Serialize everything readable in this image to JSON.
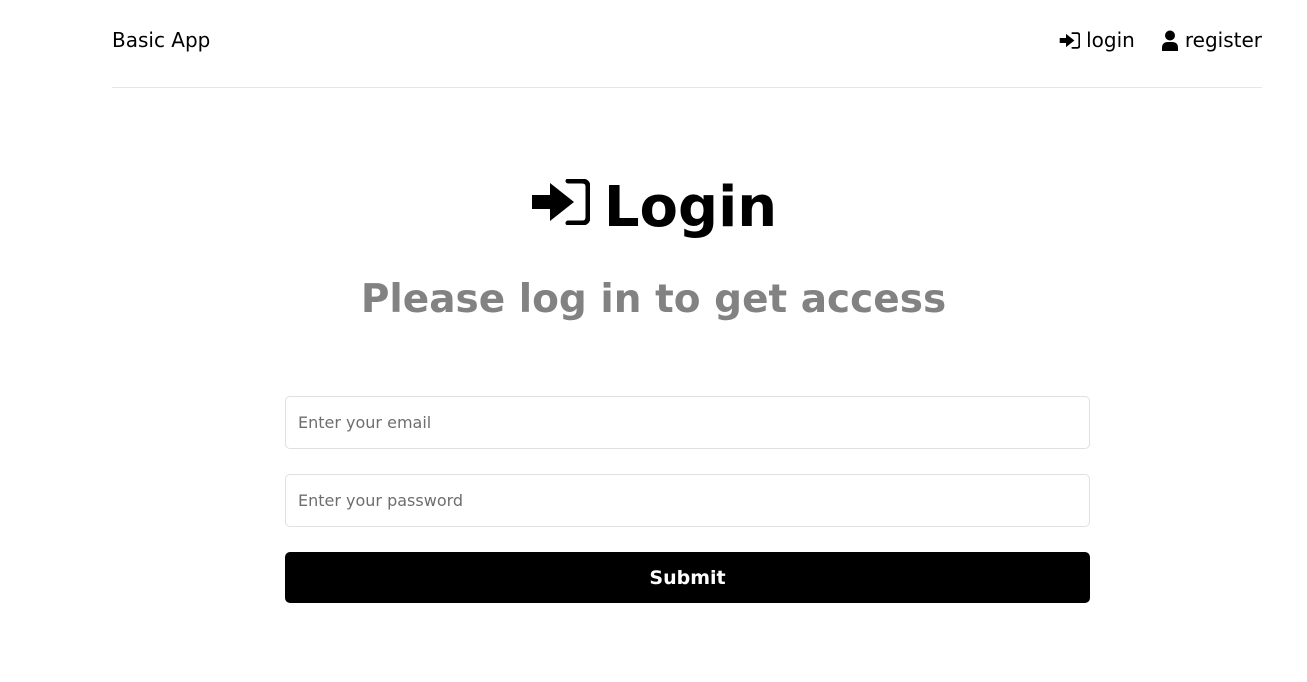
{
  "header": {
    "brand": "Basic App",
    "nav": [
      {
        "label": "login",
        "icon": "sign-in-icon"
      },
      {
        "label": "register",
        "icon": "user-icon"
      }
    ]
  },
  "hero": {
    "title": "Login",
    "icon": "sign-in-icon",
    "subtitle": "Please log in to get access"
  },
  "form": {
    "email_placeholder": "Enter your email",
    "email_value": "",
    "password_placeholder": "Enter your password",
    "password_value": "",
    "submit_label": "Submit"
  },
  "colors": {
    "background": "#ffffff",
    "text": "#000000",
    "subtitle": "#828282",
    "button_bg": "#000000",
    "button_text": "#ffffff",
    "border": "#e0e0e0"
  }
}
